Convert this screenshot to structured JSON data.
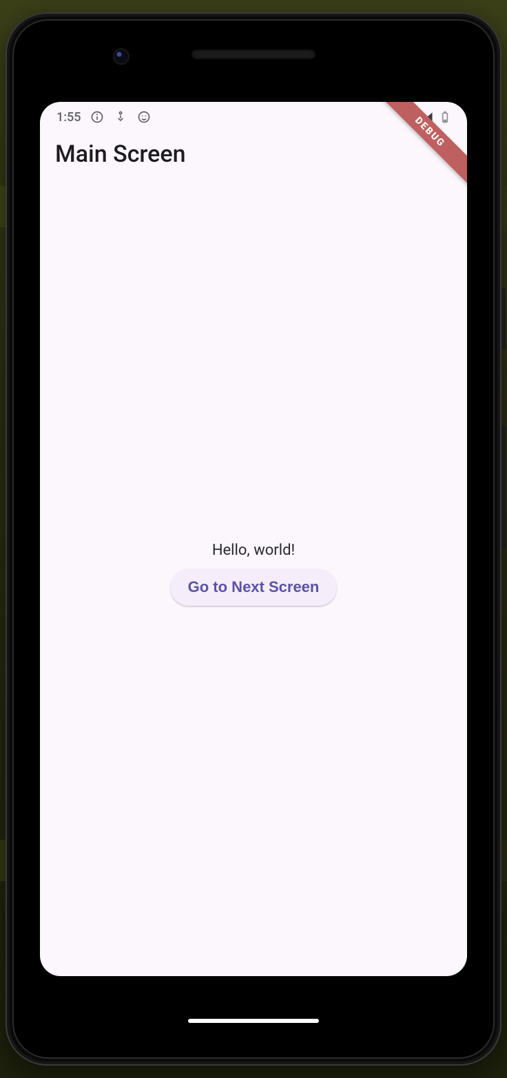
{
  "status_bar": {
    "time": "1:55",
    "icons": {
      "info": "info-icon",
      "downloads": "downloads-icon",
      "face": "face-icon"
    },
    "right": {
      "wifi": "wifi-icon",
      "cell": "cell-icon",
      "battery": "battery-icon"
    }
  },
  "debug": {
    "label": "DEBUG"
  },
  "app_bar": {
    "title": "Main Screen"
  },
  "body": {
    "greeting": "Hello, world!",
    "button_label": "Go to Next Screen"
  },
  "colors": {
    "surface": "#fbf7fc",
    "on_surface": "#1e1b20",
    "button_bg": "#f5edf9",
    "button_fg": "#5b53a6",
    "banner": "#bf6060"
  }
}
